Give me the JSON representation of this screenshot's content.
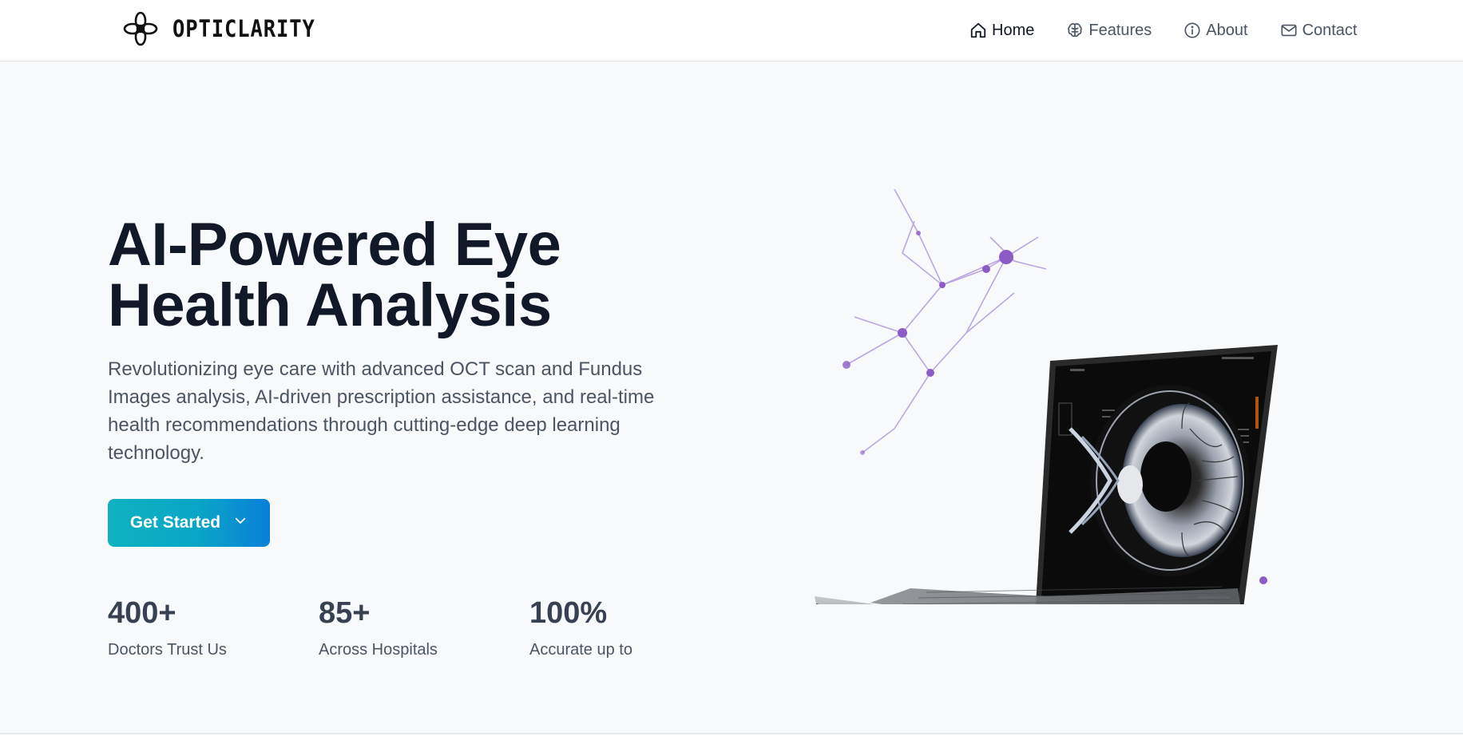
{
  "brand": {
    "name": "OPTICLARITY",
    "logo_icon": "flower-knot-icon"
  },
  "nav": {
    "items": [
      {
        "label": "Home",
        "icon": "home-icon",
        "active": true
      },
      {
        "label": "Features",
        "icon": "brain-icon",
        "active": false
      },
      {
        "label": "About",
        "icon": "info-icon",
        "active": false
      },
      {
        "label": "Contact",
        "icon": "mail-icon",
        "active": false
      }
    ]
  },
  "hero": {
    "title_line1": "AI-Powered Eye",
    "title_line2": "Health Analysis",
    "description": "Revolutionizing eye care with advanced OCT scan and Fundus Images analysis, AI-driven prescription assistance, and real-time health recommendations through cutting-edge deep learning technology.",
    "cta_label": "Get Started",
    "cta_icon": "chevron-down-icon",
    "stats": [
      {
        "value": "400+",
        "label": "Doctors Trust Us"
      },
      {
        "value": "85+",
        "label": "Across Hospitals"
      },
      {
        "value": "100%",
        "label": "Accurate up to"
      }
    ],
    "illustration": "laptop-with-retina-scan"
  },
  "colors": {
    "accent_start": "#0fb2c0",
    "accent_end": "#0a7fd9",
    "text_dark": "#111827",
    "text_muted": "#4b5563",
    "hero_bg": "#f8f9fb",
    "network_purple": "#8b5cc6"
  }
}
